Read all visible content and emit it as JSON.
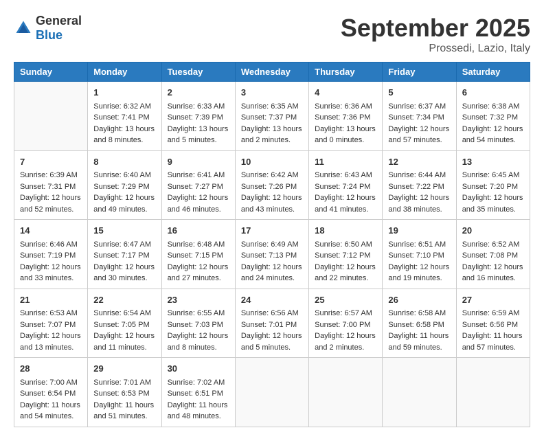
{
  "header": {
    "logo_general": "General",
    "logo_blue": "Blue",
    "title": "September 2025",
    "subtitle": "Prossedi, Lazio, Italy"
  },
  "weekdays": [
    "Sunday",
    "Monday",
    "Tuesday",
    "Wednesday",
    "Thursday",
    "Friday",
    "Saturday"
  ],
  "weeks": [
    [
      {
        "day": "",
        "sunrise": "",
        "sunset": "",
        "daylight": ""
      },
      {
        "day": "1",
        "sunrise": "Sunrise: 6:32 AM",
        "sunset": "Sunset: 7:41 PM",
        "daylight": "Daylight: 13 hours and 8 minutes."
      },
      {
        "day": "2",
        "sunrise": "Sunrise: 6:33 AM",
        "sunset": "Sunset: 7:39 PM",
        "daylight": "Daylight: 13 hours and 5 minutes."
      },
      {
        "day": "3",
        "sunrise": "Sunrise: 6:35 AM",
        "sunset": "Sunset: 7:37 PM",
        "daylight": "Daylight: 13 hours and 2 minutes."
      },
      {
        "day": "4",
        "sunrise": "Sunrise: 6:36 AM",
        "sunset": "Sunset: 7:36 PM",
        "daylight": "Daylight: 13 hours and 0 minutes."
      },
      {
        "day": "5",
        "sunrise": "Sunrise: 6:37 AM",
        "sunset": "Sunset: 7:34 PM",
        "daylight": "Daylight: 12 hours and 57 minutes."
      },
      {
        "day": "6",
        "sunrise": "Sunrise: 6:38 AM",
        "sunset": "Sunset: 7:32 PM",
        "daylight": "Daylight: 12 hours and 54 minutes."
      }
    ],
    [
      {
        "day": "7",
        "sunrise": "Sunrise: 6:39 AM",
        "sunset": "Sunset: 7:31 PM",
        "daylight": "Daylight: 12 hours and 52 minutes."
      },
      {
        "day": "8",
        "sunrise": "Sunrise: 6:40 AM",
        "sunset": "Sunset: 7:29 PM",
        "daylight": "Daylight: 12 hours and 49 minutes."
      },
      {
        "day": "9",
        "sunrise": "Sunrise: 6:41 AM",
        "sunset": "Sunset: 7:27 PM",
        "daylight": "Daylight: 12 hours and 46 minutes."
      },
      {
        "day": "10",
        "sunrise": "Sunrise: 6:42 AM",
        "sunset": "Sunset: 7:26 PM",
        "daylight": "Daylight: 12 hours and 43 minutes."
      },
      {
        "day": "11",
        "sunrise": "Sunrise: 6:43 AM",
        "sunset": "Sunset: 7:24 PM",
        "daylight": "Daylight: 12 hours and 41 minutes."
      },
      {
        "day": "12",
        "sunrise": "Sunrise: 6:44 AM",
        "sunset": "Sunset: 7:22 PM",
        "daylight": "Daylight: 12 hours and 38 minutes."
      },
      {
        "day": "13",
        "sunrise": "Sunrise: 6:45 AM",
        "sunset": "Sunset: 7:20 PM",
        "daylight": "Daylight: 12 hours and 35 minutes."
      }
    ],
    [
      {
        "day": "14",
        "sunrise": "Sunrise: 6:46 AM",
        "sunset": "Sunset: 7:19 PM",
        "daylight": "Daylight: 12 hours and 33 minutes."
      },
      {
        "day": "15",
        "sunrise": "Sunrise: 6:47 AM",
        "sunset": "Sunset: 7:17 PM",
        "daylight": "Daylight: 12 hours and 30 minutes."
      },
      {
        "day": "16",
        "sunrise": "Sunrise: 6:48 AM",
        "sunset": "Sunset: 7:15 PM",
        "daylight": "Daylight: 12 hours and 27 minutes."
      },
      {
        "day": "17",
        "sunrise": "Sunrise: 6:49 AM",
        "sunset": "Sunset: 7:13 PM",
        "daylight": "Daylight: 12 hours and 24 minutes."
      },
      {
        "day": "18",
        "sunrise": "Sunrise: 6:50 AM",
        "sunset": "Sunset: 7:12 PM",
        "daylight": "Daylight: 12 hours and 22 minutes."
      },
      {
        "day": "19",
        "sunrise": "Sunrise: 6:51 AM",
        "sunset": "Sunset: 7:10 PM",
        "daylight": "Daylight: 12 hours and 19 minutes."
      },
      {
        "day": "20",
        "sunrise": "Sunrise: 6:52 AM",
        "sunset": "Sunset: 7:08 PM",
        "daylight": "Daylight: 12 hours and 16 minutes."
      }
    ],
    [
      {
        "day": "21",
        "sunrise": "Sunrise: 6:53 AM",
        "sunset": "Sunset: 7:07 PM",
        "daylight": "Daylight: 12 hours and 13 minutes."
      },
      {
        "day": "22",
        "sunrise": "Sunrise: 6:54 AM",
        "sunset": "Sunset: 7:05 PM",
        "daylight": "Daylight: 12 hours and 11 minutes."
      },
      {
        "day": "23",
        "sunrise": "Sunrise: 6:55 AM",
        "sunset": "Sunset: 7:03 PM",
        "daylight": "Daylight: 12 hours and 8 minutes."
      },
      {
        "day": "24",
        "sunrise": "Sunrise: 6:56 AM",
        "sunset": "Sunset: 7:01 PM",
        "daylight": "Daylight: 12 hours and 5 minutes."
      },
      {
        "day": "25",
        "sunrise": "Sunrise: 6:57 AM",
        "sunset": "Sunset: 7:00 PM",
        "daylight": "Daylight: 12 hours and 2 minutes."
      },
      {
        "day": "26",
        "sunrise": "Sunrise: 6:58 AM",
        "sunset": "Sunset: 6:58 PM",
        "daylight": "Daylight: 11 hours and 59 minutes."
      },
      {
        "day": "27",
        "sunrise": "Sunrise: 6:59 AM",
        "sunset": "Sunset: 6:56 PM",
        "daylight": "Daylight: 11 hours and 57 minutes."
      }
    ],
    [
      {
        "day": "28",
        "sunrise": "Sunrise: 7:00 AM",
        "sunset": "Sunset: 6:54 PM",
        "daylight": "Daylight: 11 hours and 54 minutes."
      },
      {
        "day": "29",
        "sunrise": "Sunrise: 7:01 AM",
        "sunset": "Sunset: 6:53 PM",
        "daylight": "Daylight: 11 hours and 51 minutes."
      },
      {
        "day": "30",
        "sunrise": "Sunrise: 7:02 AM",
        "sunset": "Sunset: 6:51 PM",
        "daylight": "Daylight: 11 hours and 48 minutes."
      },
      {
        "day": "",
        "sunrise": "",
        "sunset": "",
        "daylight": ""
      },
      {
        "day": "",
        "sunrise": "",
        "sunset": "",
        "daylight": ""
      },
      {
        "day": "",
        "sunrise": "",
        "sunset": "",
        "daylight": ""
      },
      {
        "day": "",
        "sunrise": "",
        "sunset": "",
        "daylight": ""
      }
    ]
  ]
}
